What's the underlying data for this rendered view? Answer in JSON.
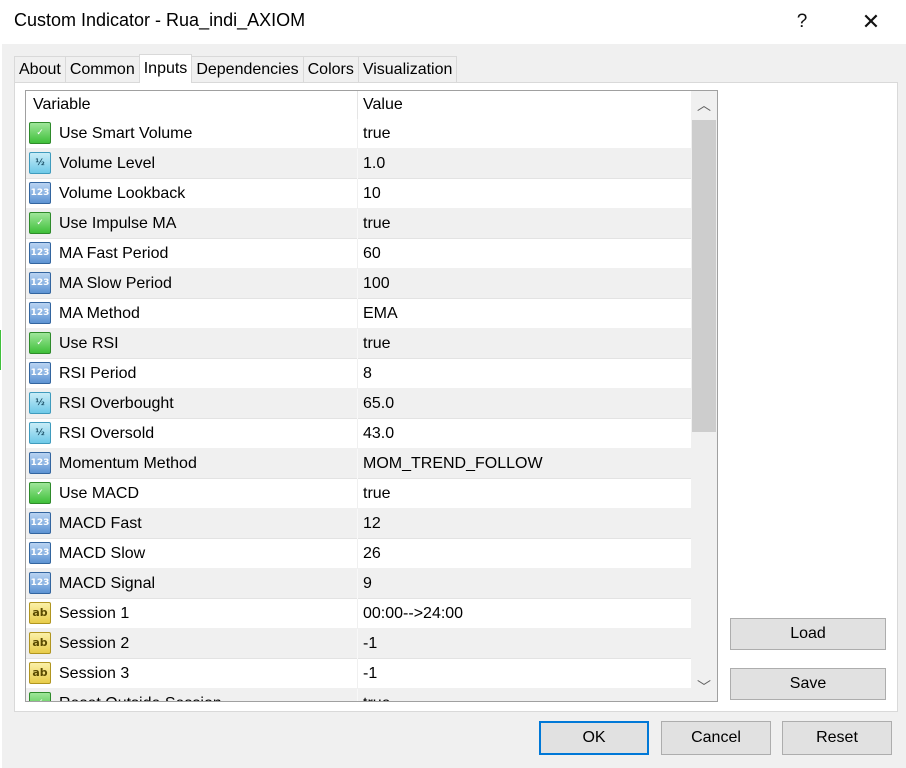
{
  "window": {
    "title": "Custom Indicator - Rua_indi_AXIOM",
    "help_label": "?",
    "close_label": "✕"
  },
  "tabs": [
    {
      "label": "About"
    },
    {
      "label": "Common"
    },
    {
      "label": "Inputs",
      "active": true
    },
    {
      "label": "Dependencies"
    },
    {
      "label": "Colors"
    },
    {
      "label": "Visualization"
    }
  ],
  "grid": {
    "headers": {
      "variable": "Variable",
      "value": "Value"
    },
    "rows": [
      {
        "icon": "bool-icon",
        "type_glyph": "✓",
        "name": "Use Smart Volume",
        "value": "true"
      },
      {
        "icon": "double-icon",
        "type_glyph": "½",
        "name": "Volume Level",
        "value": "1.0"
      },
      {
        "icon": "int-icon",
        "type_glyph": "123",
        "name": "Volume Lookback",
        "value": "10"
      },
      {
        "icon": "bool-icon",
        "type_glyph": "✓",
        "name": "Use Impulse MA",
        "value": "true"
      },
      {
        "icon": "int-icon",
        "type_glyph": "123",
        "name": "MA Fast Period",
        "value": "60"
      },
      {
        "icon": "int-icon",
        "type_glyph": "123",
        "name": "MA Slow Period",
        "value": "100"
      },
      {
        "icon": "int-icon",
        "type_glyph": "123",
        "name": "MA Method",
        "value": "EMA"
      },
      {
        "icon": "bool-icon",
        "type_glyph": "✓",
        "name": "Use RSI",
        "value": "true"
      },
      {
        "icon": "int-icon",
        "type_glyph": "123",
        "name": "RSI Period",
        "value": "8"
      },
      {
        "icon": "double-icon",
        "type_glyph": "½",
        "name": "RSI Overbought",
        "value": "65.0"
      },
      {
        "icon": "double-icon",
        "type_glyph": "½",
        "name": "RSI Oversold",
        "value": "43.0"
      },
      {
        "icon": "int-icon",
        "type_glyph": "123",
        "name": "Momentum Method",
        "value": "MOM_TREND_FOLLOW"
      },
      {
        "icon": "bool-icon",
        "type_glyph": "✓",
        "name": "Use MACD",
        "value": "true"
      },
      {
        "icon": "int-icon",
        "type_glyph": "123",
        "name": "MACD Fast",
        "value": "12"
      },
      {
        "icon": "int-icon",
        "type_glyph": "123",
        "name": "MACD Slow",
        "value": "26"
      },
      {
        "icon": "int-icon",
        "type_glyph": "123",
        "name": "MACD Signal",
        "value": "9"
      },
      {
        "icon": "string-icon",
        "type_glyph": "ab",
        "name": "Session 1",
        "value": "00:00-->24:00"
      },
      {
        "icon": "string-icon",
        "type_glyph": "ab",
        "name": "Session 2",
        "value": "-1"
      },
      {
        "icon": "string-icon",
        "type_glyph": "ab",
        "name": "Session 3",
        "value": "-1"
      },
      {
        "icon": "bool-icon",
        "type_glyph": "✓",
        "name": "Reset Outside Session",
        "value": "true"
      }
    ]
  },
  "scrollbar": {
    "up_glyph": "︿",
    "down_glyph": "﹀"
  },
  "buttons": {
    "load": "Load",
    "save": "Save",
    "ok": "OK",
    "cancel": "Cancel",
    "reset": "Reset"
  }
}
